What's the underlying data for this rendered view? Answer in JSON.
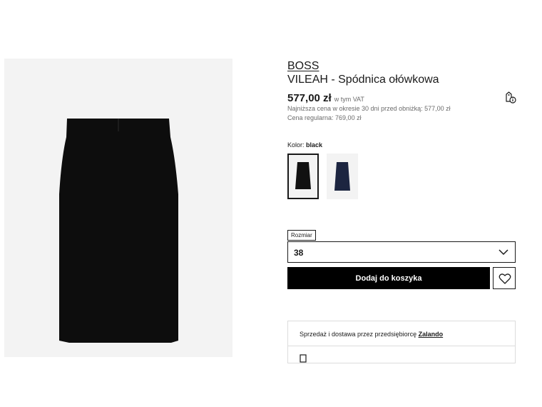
{
  "product": {
    "brand": "BOSS",
    "name": "VILEAH - Spódnica ołówkowa",
    "price": "577,00 zł",
    "vat_note": "w tym VAT",
    "lowest_price_note": "Najniższa cena w okresie 30 dni przed obniżką: 577,00 zł",
    "regular_price_note": "Cena regularna: 769,00 zł"
  },
  "color": {
    "label": "Kolor:",
    "selected": "black",
    "swatches": [
      {
        "name": "black",
        "hex": "#111111",
        "selected": true
      },
      {
        "name": "navy",
        "hex": "#1c2540",
        "selected": false
      }
    ]
  },
  "size": {
    "label": "Rozmiar",
    "value": "38"
  },
  "actions": {
    "add_to_cart": "Dodaj do koszyka"
  },
  "seller": {
    "text": "Sprzedaż i dostawa przez przedsiębiorcę",
    "name": "Zalando"
  },
  "icons": [
    "price-tag-info-icon",
    "chevron-down-icon",
    "heart-icon",
    "delivery-icon"
  ],
  "colors": {
    "button_bg": "#000000",
    "gallery_bg": "#f3f3f3",
    "muted_text": "#6b6b6b"
  }
}
